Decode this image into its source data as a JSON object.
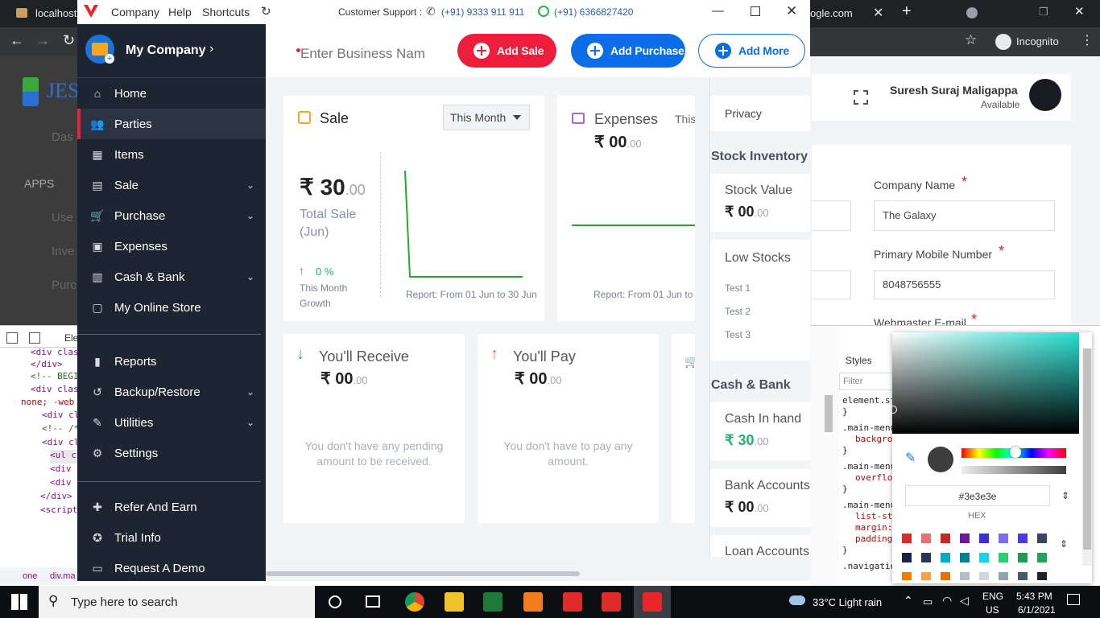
{
  "chrome": {
    "tab_left": "localhost",
    "tab_right": "ogle.com",
    "incognito": "Incognito"
  },
  "bg_page": {
    "logo": "JES",
    "apps": "APPS",
    "nav": [
      "Das",
      "Use",
      "Inve",
      "Purc"
    ],
    "user_name": "Suresh Suraj Maligappa",
    "user_status": "Available",
    "company_label": "Company Name",
    "company_value": "The Galaxy",
    "mobile_label": "Primary Mobile Number",
    "mobile_value": "8048756555",
    "email_label": "Webmaster E-mail",
    "required": "*"
  },
  "devtools": {
    "lines": [
      "<div clas",
      "</div>",
      "<!-- BEGI",
      "<div clas",
      "none; -web",
      "<div cl",
      "<!-- /*",
      "<div cl",
      "<ul c",
      "<div",
      "<div",
      "</div>",
      "<script"
    ],
    "tab_elements": "Ele",
    "styles_tab": "Styles",
    "filter": "Filter",
    "rules": [
      "element.st",
      "}",
      ".main-menu",
      "backgro",
      "}",
      ".main-menu",
      "overflo",
      "}",
      ".main-menu",
      "list-st",
      "margin:",
      "padding",
      "}",
      ".navigatio"
    ],
    "color_hex": "#3e3e3e",
    "hex_label": "HEX",
    "breadcrumb": [
      "one",
      "div.ma"
    ]
  },
  "app": {
    "titlebar": {
      "menu": [
        "Company",
        "Help",
        "Shortcuts"
      ],
      "support_label": "Customer Support :",
      "phone": "(+91) 9333 911 911",
      "whatsapp": "(+91) 6366827420"
    },
    "company": "My Company",
    "sidebar": [
      {
        "label": "Home",
        "icon": "home-icon",
        "chev": false
      },
      {
        "label": "Parties",
        "icon": "users-icon",
        "chev": false,
        "active": true
      },
      {
        "label": "Items",
        "icon": "items-icon",
        "chev": false
      },
      {
        "label": "Sale",
        "icon": "sale-icon",
        "chev": true
      },
      {
        "label": "Purchase",
        "icon": "cart-icon",
        "chev": true
      },
      {
        "label": "Expenses",
        "icon": "wallet-icon",
        "chev": false
      },
      {
        "label": "Cash & Bank",
        "icon": "bank-icon",
        "chev": true
      },
      {
        "label": "My Online Store",
        "icon": "store-icon",
        "chev": false
      },
      {
        "label": "Reports",
        "icon": "bar-chart-icon",
        "chev": false
      },
      {
        "label": "Backup/Restore",
        "icon": "backup-icon",
        "chev": true
      },
      {
        "label": "Utilities",
        "icon": "wrench-icon",
        "chev": true
      },
      {
        "label": "Settings",
        "icon": "gear-icon",
        "chev": false
      },
      {
        "label": "Refer And Earn",
        "icon": "gift-icon",
        "chev": false
      },
      {
        "label": "Trial Info",
        "icon": "badge-icon",
        "chev": false
      },
      {
        "label": "Request A Demo",
        "icon": "monitor-icon",
        "chev": false
      }
    ],
    "business_placeholder": "Enter Business Nam",
    "buttons": {
      "add_sale": "Add Sale",
      "add_purchase": "Add Purchase",
      "add_more": "Add More"
    },
    "sale": {
      "title": "Sale",
      "period": "This Month",
      "amount": "₹ 30",
      "decimals": ".00",
      "caption": "Total Sale (Jun)",
      "growth": "0 %",
      "growth_label": "This Month Growth",
      "report": "Report: From 01 Jun to 30 Jun"
    },
    "expenses": {
      "title": "Expenses",
      "period": "This",
      "amount": "₹ 00",
      "decimals": ".00",
      "report": "Report: From 01 Jun to"
    },
    "receive": {
      "title": "You'll Receive",
      "amount": "₹ 00",
      "decimals": ".00",
      "empty": "You don't have any pending amount to be received."
    },
    "pay": {
      "title": "You'll Pay",
      "amount": "₹ 00",
      "decimals": ".00",
      "empty": "You don't have to pay any amount."
    },
    "right": {
      "privacy": "Privacy",
      "stock_heading": "Stock Inventory",
      "stock_value_label": "Stock Value",
      "stock_value": "₹ 00",
      "low_stocks": "Low Stocks",
      "low_items": [
        "Test 1",
        "Test 2",
        "Test 3"
      ],
      "cash_heading": "Cash & Bank",
      "cash_in_hand": "Cash In hand",
      "cash_value": "₹ 30",
      "bank_accounts": "Bank Accounts",
      "bank_value": "₹ 00",
      "loan_accounts": "Loan Accounts",
      "decimals": ".00"
    }
  },
  "taskbar": {
    "search": "Type here to search",
    "weather": "33°C  Light rain",
    "lang": "ENG",
    "region": "US",
    "time": "5:43 PM",
    "date": "6/1/2021"
  },
  "colors": {
    "red": "#ec1e3c",
    "blue": "#0b6ee8",
    "green": "#1eb46e",
    "sidebar": "#1e2532"
  }
}
